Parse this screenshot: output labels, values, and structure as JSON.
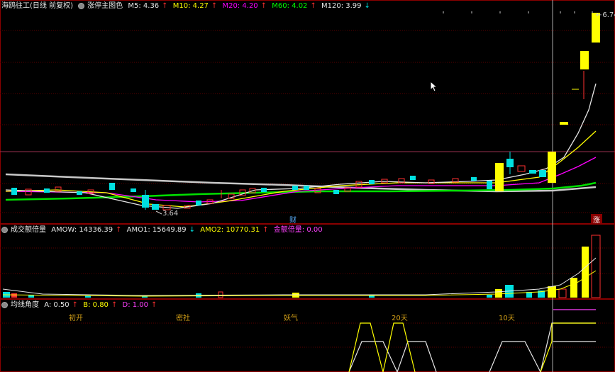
{
  "main": {
    "title": "海鸥往工(日线 前复权)",
    "indicator": "涨停主图色",
    "ma": [
      {
        "label": "M5: 4.36",
        "arrow": "↑",
        "color": "#e6e6e6",
        "arrow_color": "#ff3030"
      },
      {
        "label": "M10: 4.27",
        "arrow": "↑",
        "color": "#ffff00",
        "arrow_color": "#ff3030"
      },
      {
        "label": "M20: 4.20",
        "arrow": "↑",
        "color": "#ff00ff",
        "arrow_color": "#ff3030"
      },
      {
        "label": "M60: 4.02",
        "arrow": "↑",
        "color": "#00ff00",
        "arrow_color": "#ff3030"
      },
      {
        "label": "M120: 3.99",
        "arrow": "↓",
        "color": "#e6e6e6",
        "arrow_color": "#00e0e0"
      }
    ],
    "low_label": "3.64",
    "high_label": "6.74",
    "marker_cai": "财",
    "marker_zhang": "涨"
  },
  "volume": {
    "title": "成交额倍量",
    "items": [
      {
        "label": "AMOW: 14336.39",
        "arrow": "↑",
        "color": "#e6e6e6",
        "arrow_color": "#ff3030"
      },
      {
        "label": "AMO1: 15649.89",
        "arrow": "↓",
        "color": "#e6e6e6",
        "arrow_color": "#00e0e0"
      },
      {
        "label": "AMO2: 10770.31",
        "arrow": "↑",
        "color": "#ffff00",
        "arrow_color": "#ff3030"
      },
      {
        "label": "金额倍量: 0.00",
        "arrow": "",
        "color": "#ff40ff",
        "arrow_color": "#ff3030"
      }
    ]
  },
  "angle": {
    "title": "均线角度",
    "items": [
      {
        "label": "A: 0.50",
        "arrow": "↑",
        "color": "#e6e6e6",
        "arrow_color": "#ff3030"
      },
      {
        "label": "B: 0.80",
        "arrow": "↑",
        "color": "#ffff00",
        "arrow_color": "#ff3030"
      },
      {
        "label": "D: 1.00",
        "arrow": "↑",
        "color": "#ff40ff",
        "arrow_color": "#ff3030"
      }
    ],
    "labels": [
      "初开",
      "密社",
      "妖气",
      "20天",
      "10天"
    ]
  },
  "colors": {
    "up": "#ff3030",
    "down": "#00e0e0",
    "limit": "#ffff00",
    "grid": "#7a0000",
    "label": "#d4a017"
  },
  "icons": {
    "indicator_settings": "gear-icon"
  }
}
